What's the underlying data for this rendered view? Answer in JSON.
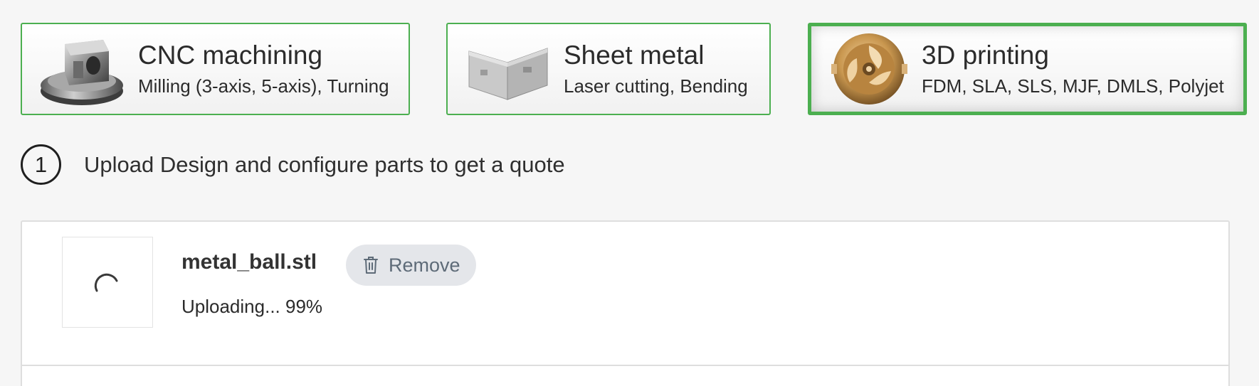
{
  "processes": [
    {
      "id": "cnc",
      "title": "CNC machining",
      "subtitle": "Milling (3-axis, 5-axis), Turning",
      "icon": "cnc-part-icon",
      "selected": false
    },
    {
      "id": "sheet",
      "title": "Sheet metal",
      "subtitle": "Laser cutting, Bending",
      "icon": "sheet-metal-part-icon",
      "selected": false
    },
    {
      "id": "3d",
      "title": "3D printing",
      "subtitle": "FDM, SLA, SLS, MJF, DMLS, Polyjet",
      "icon": "3d-printed-part-icon",
      "selected": true
    }
  ],
  "step": {
    "number": "1",
    "title": "Upload Design and configure parts to get a quote"
  },
  "upload": {
    "file_name": "metal_ball.stl",
    "remove_label": "Remove",
    "status_text": "Uploading... 99%",
    "progress": 0.99
  },
  "colors": {
    "accent": "#4caf50",
    "button_bg": "#e4e6ea",
    "button_text": "#5e6b78"
  }
}
